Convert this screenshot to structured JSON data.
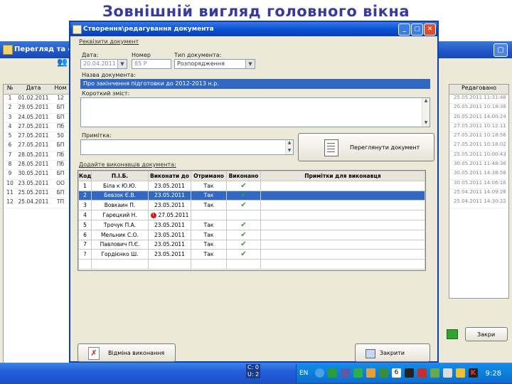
{
  "slide": {
    "title": "Зовнішній вигляд головного вікна"
  },
  "background_window": {
    "title": "Перегляд та ствс",
    "col_headers": [
      "№",
      "Дата",
      "Ном"
    ],
    "rows": [
      {
        "n": "1",
        "date": "01.02.2011",
        "num": "12"
      },
      {
        "n": "2",
        "date": "29.05.2011",
        "num": "БП"
      },
      {
        "n": "3",
        "date": "24.05.2011",
        "num": "БП"
      },
      {
        "n": "4",
        "date": "27.05.2011",
        "num": "Пб"
      },
      {
        "n": "5",
        "date": "27.05.2011",
        "num": "50"
      },
      {
        "n": "6",
        "date": "27.05.2011",
        "num": "БП"
      },
      {
        "n": "7",
        "date": "28.05.2011",
        "num": "Пб"
      },
      {
        "n": "8",
        "date": "28.05.2011",
        "num": "Пб"
      },
      {
        "n": "9",
        "date": "30.05.2011",
        "num": "БП"
      },
      {
        "n": "10",
        "date": "23.05.2011",
        "num": "ОО"
      },
      {
        "n": "11",
        "date": "25.05.2011",
        "num": "БП"
      },
      {
        "n": "12",
        "date": "25.04.2011",
        "num": "ТП"
      }
    ],
    "right_header": "Редаговано",
    "right_rows": [
      "25.05.2011 11:31:48",
      "20.05.2011 10:18:38",
      "20.05.2011 14:00:24",
      "27.05.2011 10:12:11",
      "27.05.2011 10:18:56",
      "27.05.2011 10:18:02",
      "25.05.2011 10:00:43",
      "30.05.2011 11:48:36",
      "30.05.2011 14:38:58",
      "30.05.2011 14:06:16",
      "25.04.2011 14:09:28",
      "25.04.2011 14:30:22"
    ],
    "right_button": "Закри"
  },
  "dialog": {
    "title": "Створення\\редагування документа",
    "group_label": "Реквізити документ",
    "date_label": "Дата:",
    "date_value": "20.04.2011",
    "number_label": "Номер",
    "number_value": "85 Р",
    "type_label": "Тип документа:",
    "type_value": "Розпорядження",
    "name_label": "Назва документа:",
    "name_value": "Про закінчення підготовки до 2012-2013 н.р.",
    "summary_label": "Короткий зміст:",
    "note_label": "Примітка:",
    "view_doc_button": "Переглянути документ",
    "executors_label": "Додайте виконавців документа:",
    "columns": [
      "Код",
      "П.І.Б.",
      "Виконати до",
      "Отримано",
      "Виконано",
      "Примітки для виконавця"
    ],
    "rows": [
      {
        "code": "1",
        "name": "Біла к Ю.Ю.",
        "due": "23.05.2011",
        "received": "Так",
        "done": true,
        "note": "",
        "warn": false,
        "selected": false
      },
      {
        "code": "2",
        "name": "Бевзок Є.В.",
        "due": "23.05.2011",
        "received": "Так",
        "done": true,
        "note": "",
        "warn": false,
        "selected": true
      },
      {
        "code": "3",
        "name": "Вовкаин П.",
        "due": "23.05.2011",
        "received": "Так",
        "done": true,
        "note": "",
        "warn": false,
        "selected": false
      },
      {
        "code": "4",
        "name": "Гарецкий Н.",
        "due": "27.05.2011",
        "received": "",
        "done": false,
        "note": "",
        "warn": true,
        "selected": false
      },
      {
        "code": "5",
        "name": "Трочук П.А.",
        "due": "23.05.2011",
        "received": "Так",
        "done": true,
        "note": "",
        "warn": false,
        "selected": false
      },
      {
        "code": "6",
        "name": "Мельник С.О.",
        "due": "23.05.2011",
        "received": "Так",
        "done": true,
        "note": "",
        "warn": false,
        "selected": false
      },
      {
        "code": "7",
        "name": "Павлович П.Є.",
        "due": "23.05.2011",
        "received": "Так",
        "done": true,
        "note": "",
        "warn": false,
        "selected": false
      },
      {
        "code": "?",
        "name": "Гордієнко Ш.",
        "due": "23.05.2011",
        "received": "Так",
        "done": true,
        "note": "",
        "warn": false,
        "selected": false
      }
    ],
    "cancel_execution_button": "Відміна виконання",
    "close_button": "Закрити"
  },
  "taskbar": {
    "lang": "EN",
    "clock": "9:28",
    "cpu_line1": "С: 0",
    "cpu_line2": "U: 2",
    "tray_badge": "6"
  },
  "colors": {
    "title_blue": "#3a3a9e",
    "selection": "#3168c4",
    "xp_title": "#0a52d8"
  }
}
